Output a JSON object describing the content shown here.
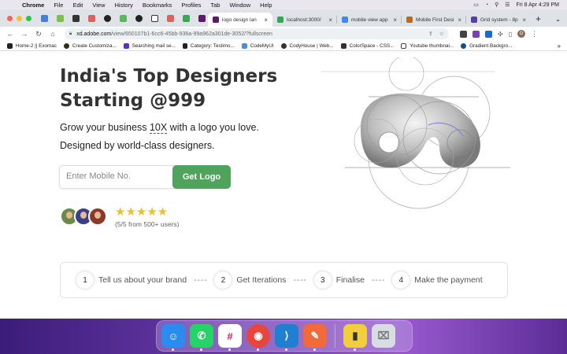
{
  "menubar": {
    "app": "Chrome",
    "items": [
      "File",
      "Edit",
      "View",
      "History",
      "Bookmarks",
      "Profiles",
      "Tab",
      "Window",
      "Help"
    ],
    "clock": "Fri 8 Apr  4:29 PM"
  },
  "tabs": [
    {
      "title": "logo design lan",
      "color": "#5c1a6b",
      "active": true
    },
    {
      "title": "localhost:3000/",
      "color": "#2fa84f",
      "active": false
    },
    {
      "title": "mobile view app",
      "color": "#4285f4",
      "active": false
    },
    {
      "title": "Mobile First Desi",
      "color": "#b06a2a",
      "active": false
    },
    {
      "title": "Grid system - 8p",
      "color": "#5b3fa0",
      "active": false
    }
  ],
  "address": {
    "host": "xd.adobe.com",
    "path": "/view/650107b1-6cc6-45bb-936a-99a962a301de-3052/?fullscreen"
  },
  "profile_initial": "G",
  "bookmarks": [
    {
      "label": "Home-2 || Exomac",
      "color": "#222"
    },
    {
      "label": "Create Customiza...",
      "color": "#3a2a1a"
    },
    {
      "label": "Searching mail se...",
      "color": "#5a2fc8"
    },
    {
      "label": "Category: Testimo...",
      "color": "#222"
    },
    {
      "label": "CodeMyUI",
      "color": "#4a90d9"
    },
    {
      "label": "CodyHouse | Web...",
      "color": "#333"
    },
    {
      "label": "ColorSpace - CSS...",
      "color": "#333"
    },
    {
      "label": "Youtube thumbnai...",
      "color": "#444"
    },
    {
      "label": "Gradient Backgro...",
      "color": "#1a4a8a"
    }
  ],
  "hero": {
    "title_line1": "India's Top Designers",
    "title_line2": "Starting @999",
    "sub_pre": "Grow your business ",
    "sub_highlight": "10X",
    "sub_post": " with a logo you love.",
    "sub2": "Designed by world-class designers.",
    "input_placeholder": "Enter Mobile No.",
    "cta": "Get Logo",
    "stars": "★★★★★",
    "rating_text": "(5/5 from 500+ users)"
  },
  "steps": [
    {
      "num": "1",
      "label": "Tell us about your brand"
    },
    {
      "num": "2",
      "label": "Get Iterations"
    },
    {
      "num": "3",
      "label": "Finalise"
    },
    {
      "num": "4",
      "label": "Make the payment"
    }
  ],
  "step_separator": "----",
  "colors": {
    "cta_green": "#4fa35a",
    "star_gold": "#f0be2b",
    "title_text": "#333333"
  },
  "dock": [
    {
      "icon": "finder-icon",
      "color": "#2b8cf0",
      "glyph": "☺"
    },
    {
      "icon": "whatsapp-icon",
      "color": "#25d366",
      "glyph": "✆"
    },
    {
      "icon": "slack-icon",
      "color": "#ffffff",
      "glyph": "#"
    },
    {
      "icon": "chrome-icon",
      "color": "#e8453c",
      "glyph": "◉"
    },
    {
      "icon": "vscode-icon",
      "color": "#1f7fd0",
      "glyph": "⟩"
    },
    {
      "icon": "postman-icon",
      "color": "#f06a3a",
      "glyph": "✎"
    },
    {
      "icon": "sticky-icon",
      "color": "#f2cd3c",
      "glyph": "▮"
    },
    {
      "icon": "trash-icon",
      "color": "#d8dde3",
      "glyph": "🗑"
    }
  ]
}
